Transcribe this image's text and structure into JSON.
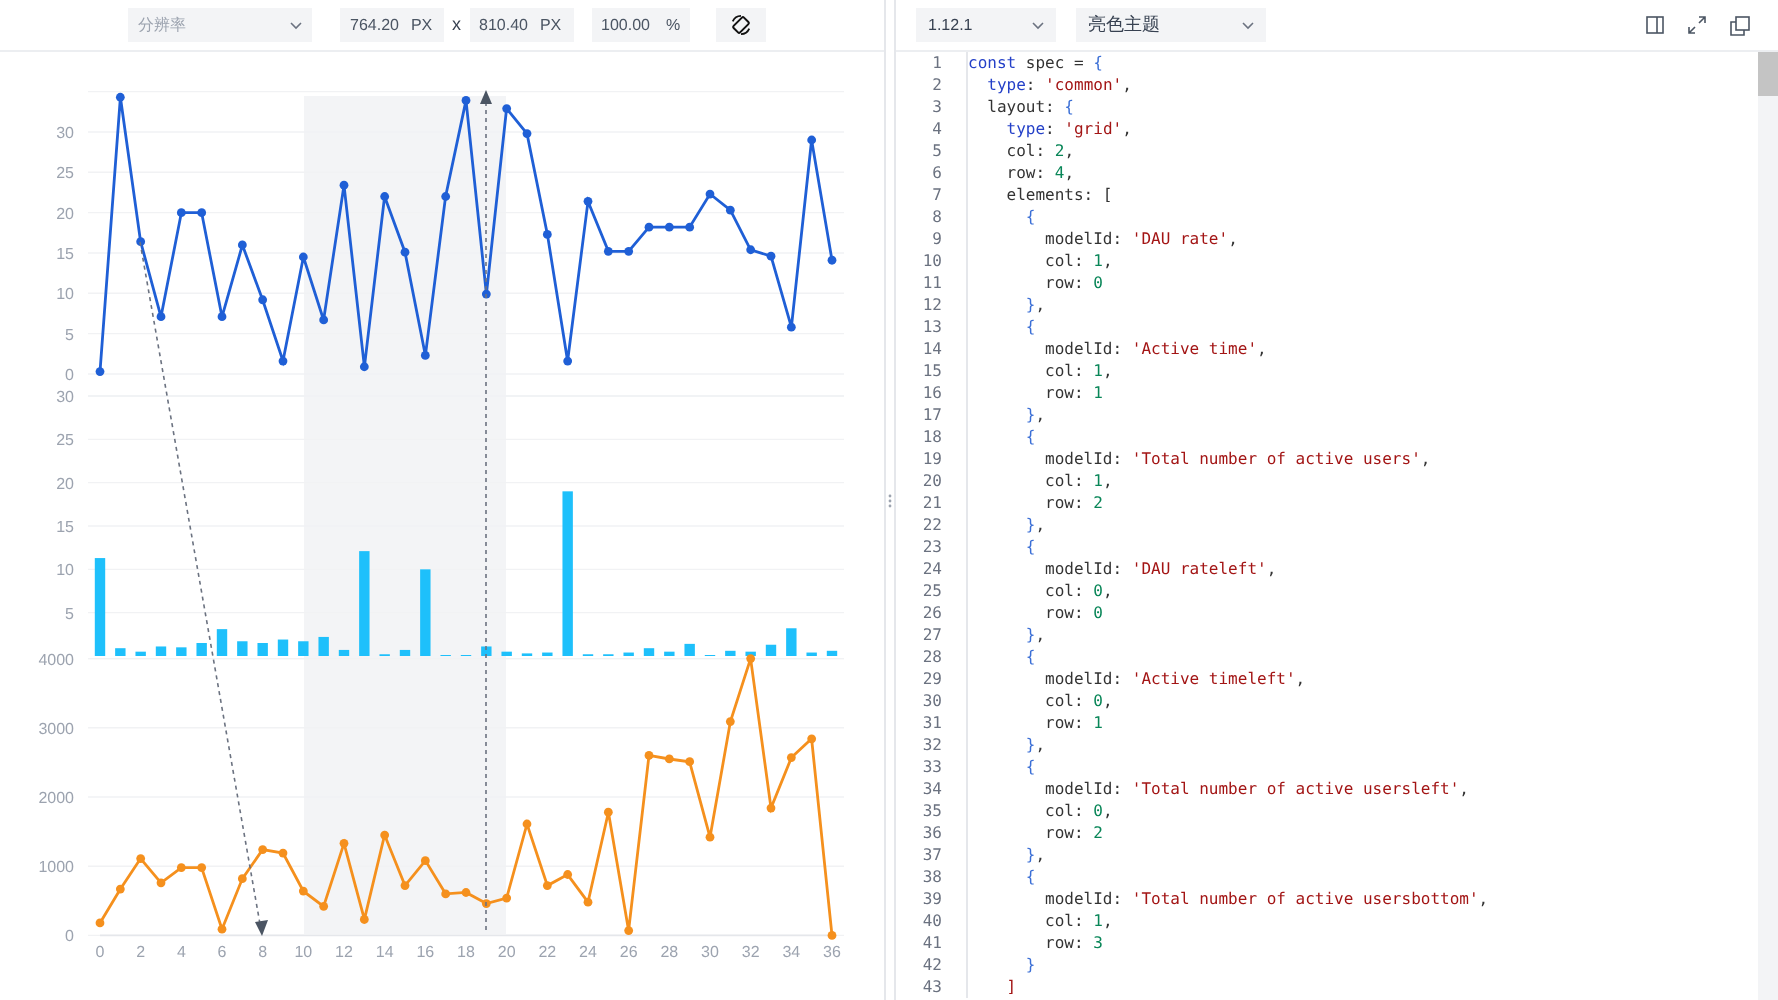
{
  "preview_toolbar": {
    "resolution_select": {
      "placeholder": "分辨率"
    },
    "width_field": {
      "value": "764.20",
      "unit": "PX"
    },
    "times_sign": "x",
    "height_field": {
      "value": "810.40",
      "unit": "PX"
    },
    "zoom_field": {
      "value": "100.00",
      "unit": "%"
    }
  },
  "charts": [
    {
      "chart_data": {
        "type": "line",
        "ylim": [
          0,
          35
        ],
        "grid": true,
        "series": [
          {
            "color": "#1f5fd6",
            "marker": "circle",
            "values": [
              0.3,
              34.3,
              16.4,
              7.1,
              20,
              20,
              7.1,
              16,
              9.2,
              1.6,
              14.5,
              6.7,
              23.4,
              0.9,
              22,
              15.1,
              2.3,
              22,
              33.9,
              9.9,
              32.9,
              29.8,
              17.3,
              1.6,
              21.4,
              15.2,
              15.2,
              18.2,
              18.2,
              18.2,
              22.3,
              20.3,
              15.4,
              14.6,
              5.8,
              29,
              14.1
            ]
          }
        ],
        "yticks": [
          0,
          5,
          10,
          15,
          20,
          25,
          30
        ]
      }
    },
    {
      "chart_data": {
        "type": "bar",
        "ylim": [
          0,
          30
        ],
        "grid": true,
        "series": [
          {
            "color": "#1ec0fb",
            "values": [
              11.3,
              0.9,
              0.5,
              1.1,
              1,
              1.5,
              3.1,
              1.7,
              1.5,
              1.9,
              1.7,
              2.2,
              0.7,
              12.1,
              0.2,
              0.7,
              10,
              0.1,
              0.1,
              1.1,
              0.5,
              0.3,
              0.4,
              19,
              0.2,
              0.2,
              0.4,
              0.9,
              0.5,
              1.4,
              0,
              0.6,
              0.5,
              1.3,
              3.2,
              0.4,
              0.6
            ]
          }
        ],
        "yticks": [
          5,
          10,
          15,
          20,
          25,
          30
        ]
      }
    },
    {
      "chart_data": {
        "type": "line",
        "x": [
          0,
          1,
          2,
          3,
          4,
          5,
          6,
          7,
          8,
          9,
          10,
          11,
          12,
          13,
          14,
          15,
          16,
          17,
          18,
          19,
          20,
          21,
          22,
          23,
          24,
          25,
          26,
          27,
          28,
          29,
          30,
          31,
          32,
          33,
          34,
          35,
          36
        ],
        "xlim": [
          0,
          36
        ],
        "ylim": [
          0,
          4000
        ],
        "grid": true,
        "series": [
          {
            "color": "#f5901d",
            "marker": "circle",
            "values": [
              180,
              670,
              1110,
              760,
              980,
              980,
              90,
              820,
              1240,
              1190,
              640,
              420,
              1330,
              230,
              1450,
              720,
              1080,
              600,
              620,
              460,
              540,
              1610,
              720,
              880,
              480,
              1780,
              70,
              2600,
              2550,
              2510,
              1420,
              3090,
              4000,
              1840,
              2570,
              2840,
              0
            ]
          }
        ],
        "yticks": [
          0,
          1000,
          2000,
          3000,
          4000
        ],
        "xticks": [
          0,
          2,
          4,
          6,
          8,
          10,
          12,
          14,
          16,
          18,
          20,
          22,
          24,
          26,
          28,
          30,
          32,
          34,
          36
        ]
      }
    }
  ],
  "editor_toolbar": {
    "version_select": {
      "value": "1.12.1"
    },
    "theme_select": {
      "value": "亮色主题"
    }
  },
  "code_lines": [
    {
      "number": "1",
      "segments": [
        {
          "text": "const",
          "kind": "keyword"
        },
        {
          "text": " spec = ",
          "kind": "plain"
        },
        {
          "text": "{",
          "kind": "brace"
        }
      ]
    },
    {
      "number": "2",
      "segments": [
        {
          "text": "  type",
          "kind": "keyword"
        },
        {
          "text": ": ",
          "kind": "plain"
        },
        {
          "text": "'common'",
          "kind": "string"
        },
        {
          "text": ",",
          "kind": "plain"
        }
      ]
    },
    {
      "number": "3",
      "segments": [
        {
          "text": "  layout: ",
          "kind": "plain"
        },
        {
          "text": "{",
          "kind": "brace"
        }
      ]
    },
    {
      "number": "4",
      "segments": [
        {
          "text": "    type",
          "kind": "keyword"
        },
        {
          "text": ": ",
          "kind": "plain"
        },
        {
          "text": "'grid'",
          "kind": "string"
        },
        {
          "text": ",",
          "kind": "plain"
        }
      ]
    },
    {
      "number": "5",
      "segments": [
        {
          "text": "    col: ",
          "kind": "plain"
        },
        {
          "text": "2",
          "kind": "number"
        },
        {
          "text": ",",
          "kind": "plain"
        }
      ]
    },
    {
      "number": "6",
      "segments": [
        {
          "text": "    row: ",
          "kind": "plain"
        },
        {
          "text": "4",
          "kind": "number"
        },
        {
          "text": ",",
          "kind": "plain"
        }
      ]
    },
    {
      "number": "7",
      "segments": [
        {
          "text": "    elements: [",
          "kind": "plain"
        }
      ]
    },
    {
      "number": "8",
      "segments": [
        {
          "text": "      {",
          "kind": "brace"
        }
      ]
    },
    {
      "number": "9",
      "segments": [
        {
          "text": "        modelId: ",
          "kind": "plain"
        },
        {
          "text": "'DAU rate'",
          "kind": "string"
        },
        {
          "text": ",",
          "kind": "plain"
        }
      ]
    },
    {
      "number": "10",
      "segments": [
        {
          "text": "        col: ",
          "kind": "plain"
        },
        {
          "text": "1",
          "kind": "number"
        },
        {
          "text": ",",
          "kind": "plain"
        }
      ]
    },
    {
      "number": "11",
      "segments": [
        {
          "text": "        row: ",
          "kind": "plain"
        },
        {
          "text": "0",
          "kind": "number"
        }
      ]
    },
    {
      "number": "12",
      "segments": [
        {
          "text": "      }",
          "kind": "brace"
        },
        {
          "text": ",",
          "kind": "plain"
        }
      ]
    },
    {
      "number": "13",
      "segments": [
        {
          "text": "      {",
          "kind": "brace"
        }
      ]
    },
    {
      "number": "14",
      "segments": [
        {
          "text": "        modelId: ",
          "kind": "plain"
        },
        {
          "text": "'Active time'",
          "kind": "string"
        },
        {
          "text": ",",
          "kind": "plain"
        }
      ]
    },
    {
      "number": "15",
      "segments": [
        {
          "text": "        col: ",
          "kind": "plain"
        },
        {
          "text": "1",
          "kind": "number"
        },
        {
          "text": ",",
          "kind": "plain"
        }
      ]
    },
    {
      "number": "16",
      "segments": [
        {
          "text": "        row: ",
          "kind": "plain"
        },
        {
          "text": "1",
          "kind": "number"
        }
      ]
    },
    {
      "number": "17",
      "segments": [
        {
          "text": "      }",
          "kind": "brace"
        },
        {
          "text": ",",
          "kind": "plain"
        }
      ]
    },
    {
      "number": "18",
      "segments": [
        {
          "text": "      {",
          "kind": "brace"
        }
      ]
    },
    {
      "number": "19",
      "segments": [
        {
          "text": "        modelId: ",
          "kind": "plain"
        },
        {
          "text": "'Total number of active users'",
          "kind": "string"
        },
        {
          "text": ",",
          "kind": "plain"
        }
      ]
    },
    {
      "number": "20",
      "segments": [
        {
          "text": "        col: ",
          "kind": "plain"
        },
        {
          "text": "1",
          "kind": "number"
        },
        {
          "text": ",",
          "kind": "plain"
        }
      ]
    },
    {
      "number": "21",
      "segments": [
        {
          "text": "        row: ",
          "kind": "plain"
        },
        {
          "text": "2",
          "kind": "number"
        }
      ]
    },
    {
      "number": "22",
      "segments": [
        {
          "text": "      }",
          "kind": "brace"
        },
        {
          "text": ",",
          "kind": "plain"
        }
      ]
    },
    {
      "number": "23",
      "segments": [
        {
          "text": "      {",
          "kind": "brace"
        }
      ]
    },
    {
      "number": "24",
      "segments": [
        {
          "text": "        modelId: ",
          "kind": "plain"
        },
        {
          "text": "'DAU rateleft'",
          "kind": "string"
        },
        {
          "text": ",",
          "kind": "plain"
        }
      ]
    },
    {
      "number": "25",
      "segments": [
        {
          "text": "        col: ",
          "kind": "plain"
        },
        {
          "text": "0",
          "kind": "number"
        },
        {
          "text": ",",
          "kind": "plain"
        }
      ]
    },
    {
      "number": "26",
      "segments": [
        {
          "text": "        row: ",
          "kind": "plain"
        },
        {
          "text": "0",
          "kind": "number"
        }
      ]
    },
    {
      "number": "27",
      "segments": [
        {
          "text": "      }",
          "kind": "brace"
        },
        {
          "text": ",",
          "kind": "plain"
        }
      ]
    },
    {
      "number": "28",
      "segments": [
        {
          "text": "      {",
          "kind": "brace"
        }
      ]
    },
    {
      "number": "29",
      "segments": [
        {
          "text": "        modelId: ",
          "kind": "plain"
        },
        {
          "text": "'Active timeleft'",
          "kind": "string"
        },
        {
          "text": ",",
          "kind": "plain"
        }
      ]
    },
    {
      "number": "30",
      "segments": [
        {
          "text": "        col: ",
          "kind": "plain"
        },
        {
          "text": "0",
          "kind": "number"
        },
        {
          "text": ",",
          "kind": "plain"
        }
      ]
    },
    {
      "number": "31",
      "segments": [
        {
          "text": "        row: ",
          "kind": "plain"
        },
        {
          "text": "1",
          "kind": "number"
        }
      ]
    },
    {
      "number": "32",
      "segments": [
        {
          "text": "      }",
          "kind": "brace"
        },
        {
          "text": ",",
          "kind": "plain"
        }
      ]
    },
    {
      "number": "33",
      "segments": [
        {
          "text": "      {",
          "kind": "brace"
        }
      ]
    },
    {
      "number": "34",
      "segments": [
        {
          "text": "        modelId: ",
          "kind": "plain"
        },
        {
          "text": "'Total number of active usersleft'",
          "kind": "string"
        },
        {
          "text": ",",
          "kind": "plain"
        }
      ]
    },
    {
      "number": "35",
      "segments": [
        {
          "text": "        col: ",
          "kind": "plain"
        },
        {
          "text": "0",
          "kind": "number"
        },
        {
          "text": ",",
          "kind": "plain"
        }
      ]
    },
    {
      "number": "36",
      "segments": [
        {
          "text": "        row: ",
          "kind": "plain"
        },
        {
          "text": "2",
          "kind": "number"
        }
      ]
    },
    {
      "number": "37",
      "segments": [
        {
          "text": "      }",
          "kind": "brace"
        },
        {
          "text": ",",
          "kind": "plain"
        }
      ]
    },
    {
      "number": "38",
      "segments": [
        {
          "text": "      {",
          "kind": "brace"
        }
      ]
    },
    {
      "number": "39",
      "segments": [
        {
          "text": "        modelId: ",
          "kind": "plain"
        },
        {
          "text": "'Total number of active usersbottom'",
          "kind": "string"
        },
        {
          "text": ",",
          "kind": "plain"
        }
      ]
    },
    {
      "number": "40",
      "segments": [
        {
          "text": "        col: ",
          "kind": "plain"
        },
        {
          "text": "1",
          "kind": "number"
        },
        {
          "text": ",",
          "kind": "plain"
        }
      ]
    },
    {
      "number": "41",
      "segments": [
        {
          "text": "        row: ",
          "kind": "plain"
        },
        {
          "text": "3",
          "kind": "number"
        }
      ]
    },
    {
      "number": "42",
      "segments": [
        {
          "text": "      }",
          "kind": "brace"
        }
      ]
    },
    {
      "number": "43",
      "segments": [
        {
          "text": "    ]",
          "kind": "string"
        }
      ]
    }
  ]
}
